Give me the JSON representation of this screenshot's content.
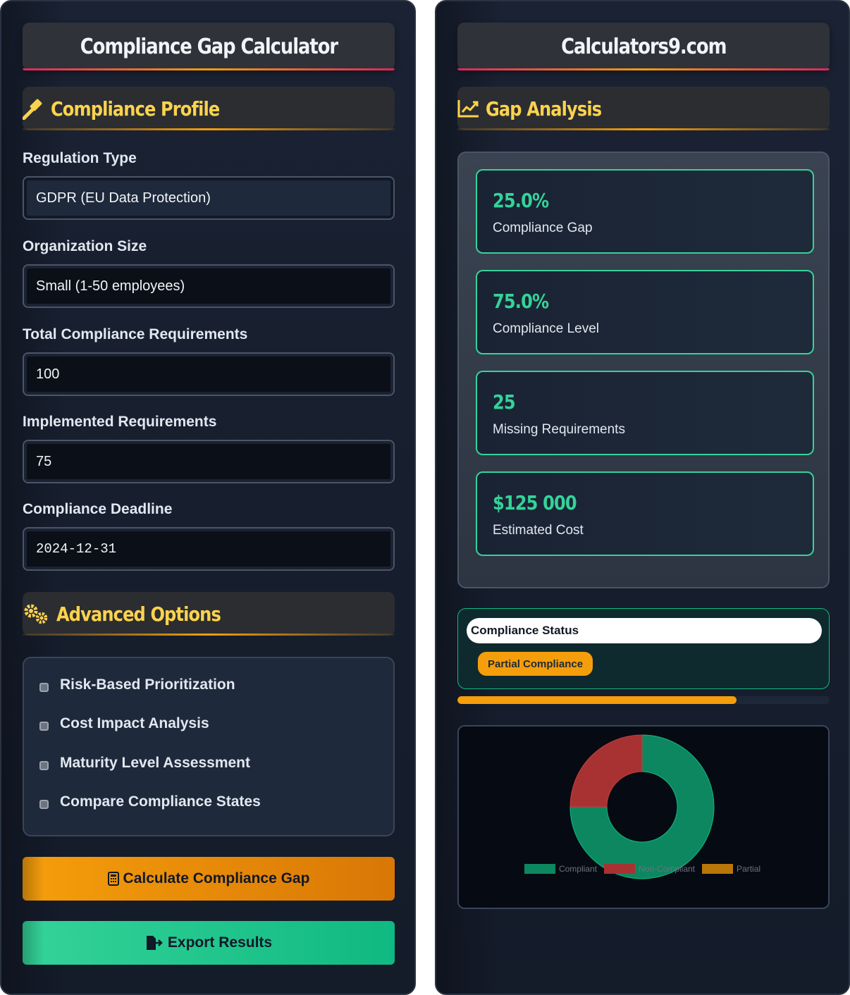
{
  "left_panel": {
    "title": "Compliance Gap Calculator",
    "profile_section": {
      "title": "Compliance Profile",
      "icon": "gavel-icon"
    },
    "fields": {
      "regulation_type": {
        "label": "Regulation Type",
        "value": "GDPR (EU Data Protection)"
      },
      "organization_size": {
        "label": "Organization Size",
        "value": "Small (1-50 employees)"
      },
      "total_requirements": {
        "label": "Total Compliance Requirements",
        "value": "100"
      },
      "implemented_requirements": {
        "label": "Implemented Requirements",
        "value": "75"
      },
      "deadline": {
        "label": "Compliance Deadline",
        "value": "2024-12-31"
      }
    },
    "advanced_section": {
      "title": "Advanced Options",
      "icon": "gears-icon"
    },
    "options": [
      {
        "label": "Risk-Based Prioritization",
        "checked": false
      },
      {
        "label": "Cost Impact Analysis",
        "checked": false
      },
      {
        "label": "Maturity Level Assessment",
        "checked": false
      },
      {
        "label": "Compare Compliance States",
        "checked": false
      }
    ],
    "buttons": {
      "calculate": {
        "label": "Calculate Compliance Gap",
        "icon": "calculator-icon"
      },
      "export": {
        "label": "Export Results",
        "icon": "file-export-icon"
      }
    }
  },
  "right_panel": {
    "title": "Calculators9.com",
    "analysis_section": {
      "title": "Gap Analysis",
      "icon": "line-chart-icon"
    },
    "results": [
      {
        "value": "25.0%",
        "label": "Compliance Gap"
      },
      {
        "value": "75.0%",
        "label": "Compliance Level"
      },
      {
        "value": "25",
        "label": "Missing Requirements"
      },
      {
        "value": "$125 000",
        "label": "Estimated Cost"
      }
    ],
    "status": {
      "title": "Compliance Status",
      "badge": "Partial Compliance",
      "progress": 0.75
    },
    "colors": {
      "accent": "#f59e0b",
      "success": "#34d399",
      "compliant": "#0d8760",
      "non_compliant": "#a83232",
      "partial": "#b97609"
    }
  },
  "chart_data": {
    "type": "pie",
    "donut": true,
    "categories": [
      "Compliant",
      "Non-Compliant",
      "Partial"
    ],
    "values": [
      75,
      25,
      0
    ],
    "legend": "bottom"
  }
}
